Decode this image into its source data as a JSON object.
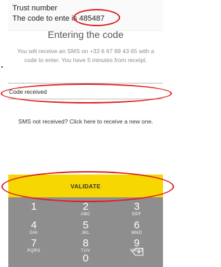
{
  "notification": {
    "title": "Trust number",
    "prefix": "The code to ente",
    "code": "is 485487"
  },
  "screen": {
    "title": "Entering the code",
    "description": "You will receive an SMS on +33 6 67 89 43 65 with a code to enter. You have 5 minutes from receipt.",
    "code_field_value": "Code received",
    "resend_link": "SMS not received? Click here to receive a new one.",
    "validate_label": "VALIDATE"
  },
  "keypad": {
    "keys": [
      {
        "digit": "1",
        "letters": ""
      },
      {
        "digit": "2",
        "letters": "ABC"
      },
      {
        "digit": "3",
        "letters": "DEF"
      },
      {
        "digit": "4",
        "letters": "GHI"
      },
      {
        "digit": "5",
        "letters": "JKL"
      },
      {
        "digit": "6",
        "letters": "MNO"
      },
      {
        "digit": "7",
        "letters": "PQRS"
      },
      {
        "digit": "8",
        "letters": "TUV"
      },
      {
        "digit": "9",
        "letters": "WXYZ"
      },
      {
        "digit": "0",
        "letters": ""
      }
    ]
  },
  "colors": {
    "validate": "#f6d800",
    "keypad": "#8e8e8e",
    "annotation": "#e02020"
  }
}
